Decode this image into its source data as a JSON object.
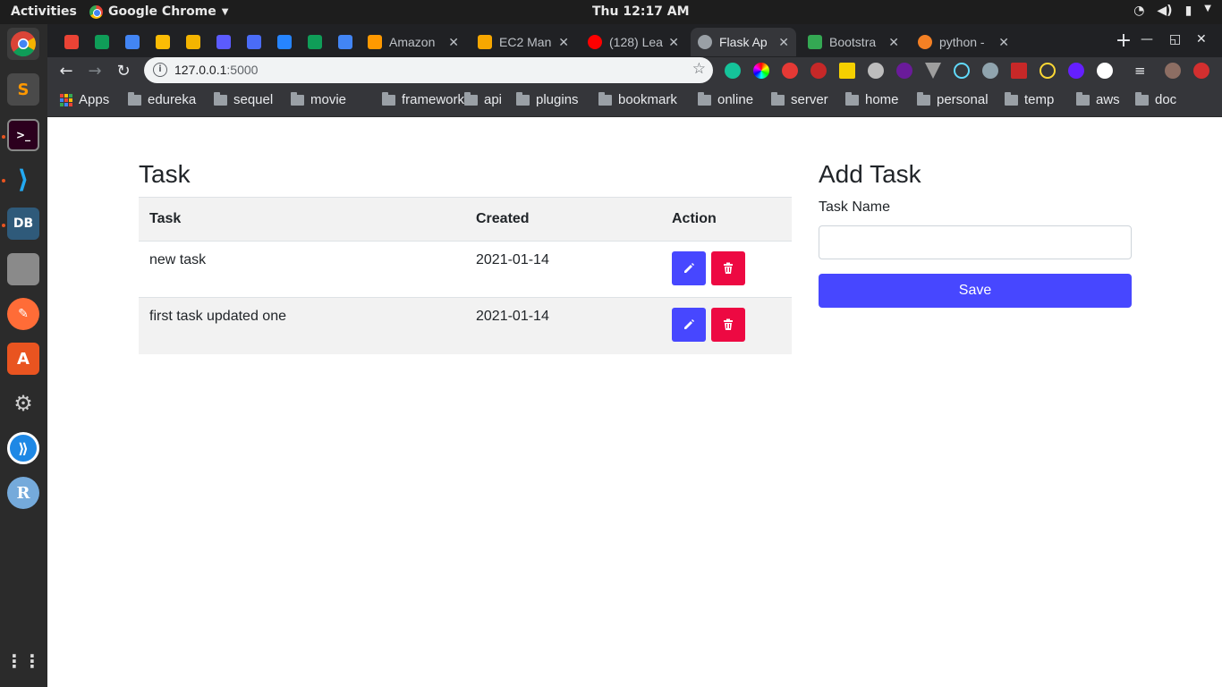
{
  "topbar": {
    "activities": "Activities",
    "app_name": "Google Chrome",
    "clock": "Thu 12:17 AM"
  },
  "browser": {
    "tabs": [
      {
        "title": "",
        "icon": "gmail-icon",
        "color": "#ea4335"
      },
      {
        "title": "",
        "icon": "hangouts-icon",
        "color": "#0f9d58"
      },
      {
        "title": "",
        "icon": "calendar-icon",
        "color": "#4285f4"
      },
      {
        "title": "",
        "icon": "drive-icon",
        "color": "#fbbc05"
      },
      {
        "title": "",
        "icon": "keep-icon",
        "color": "#f4b400"
      },
      {
        "title": "",
        "icon": "app-icon",
        "color": "#5b5bff"
      },
      {
        "title": "",
        "icon": "app-icon-2",
        "color": "#4a6cf7"
      },
      {
        "title": "",
        "icon": "jira-icon",
        "color": "#2684ff"
      },
      {
        "title": "",
        "icon": "sheets-icon",
        "color": "#0f9d58"
      },
      {
        "title": "",
        "icon": "docs-icon",
        "color": "#4285f4"
      },
      {
        "title": "Amazon",
        "icon": "aws-icon",
        "color": "#ff9900"
      },
      {
        "title": "EC2 Man",
        "icon": "ec2-icon",
        "color": "#f7a700"
      },
      {
        "title": "(128) Lea",
        "icon": "youtube-icon",
        "color": "#ff0000"
      },
      {
        "title": "Flask Ap",
        "icon": "globe-icon",
        "color": "#9aa0a6"
      },
      {
        "title": "Bootstra",
        "icon": "bootstrap-icon",
        "color": "#34a853"
      },
      {
        "title": "python -",
        "icon": "stackoverflow-icon",
        "color": "#f48024"
      }
    ],
    "url": "127.0.0.1",
    "url_port": ":5000",
    "bookmarks": [
      "Apps",
      "edureka",
      "sequel",
      "movie",
      "framework",
      "api",
      "plugins",
      "bookmark",
      "online",
      "server",
      "home",
      "personal",
      "temp",
      "aws",
      "doc"
    ]
  },
  "tasks_section": {
    "title": "Task",
    "headers": [
      "Task",
      "Created",
      "Action"
    ],
    "rows": [
      {
        "task": "new task",
        "created": "2021-01-14"
      },
      {
        "task": "first task updated one",
        "created": "2021-01-14"
      }
    ]
  },
  "add_task": {
    "title": "Add Task",
    "label": "Task Name",
    "input_value": "",
    "save_label": "Save"
  },
  "colors": {
    "primary": "#4747ff",
    "danger": "#ed0942",
    "stripe": "#f2f2f2"
  }
}
